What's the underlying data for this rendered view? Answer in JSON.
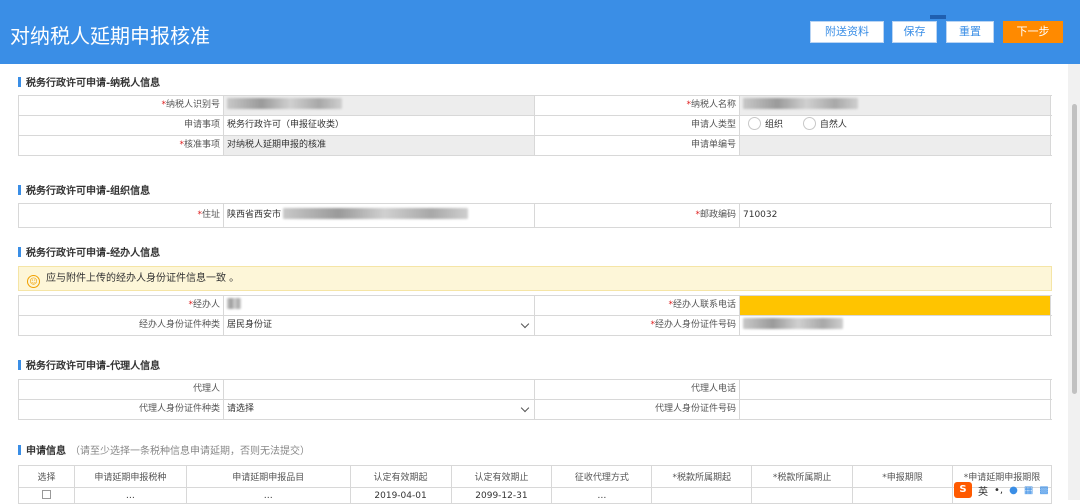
{
  "header": {
    "title": "对纳税人延期申报核准",
    "buttons": {
      "attach": "附送资料",
      "save": "保存",
      "reset": "重置",
      "next": "下一步"
    }
  },
  "sections": {
    "taxpayer": "税务行政许可申请-纳税人信息",
    "org": "税务行政许可申请-组织信息",
    "agent": "税务行政许可申请-经办人信息",
    "proxy": "税务行政许可申请-代理人信息",
    "apply": "申请信息",
    "apply_hint": "（请至少选择一条税种信息申请延期，否则无法提交）"
  },
  "taxpayer": {
    "id_label": "纳税人识别号",
    "name_label": "纳税人名称",
    "item_label": "申请事项",
    "item_value": "税务行政许可（申报征收类）",
    "type_label": "申请人类型",
    "type_opt1": "组织",
    "type_opt2": "自然人",
    "approve_label": "核准事项",
    "approve_value": "对纳税人延期申报的核准",
    "doc_label": "申请单编号"
  },
  "org": {
    "address_label": "住址",
    "address_value": "陕西省西安市",
    "zip_label": "邮政编码",
    "zip_value": "710032"
  },
  "agent": {
    "notice": "应与附件上传的经办人身份证件信息一致 。",
    "name_label": "经办人",
    "phone_label": "经办人联系电话",
    "idtype_label": "经办人身份证件种类",
    "idtype_value": "居民身份证",
    "idno_label": "经办人身份证件号码"
  },
  "proxy": {
    "name_label": "代理人",
    "phone_label": "代理人电话",
    "idtype_label": "代理人身份证件种类",
    "idtype_value": "请选择",
    "idno_label": "代理人身份证件号码"
  },
  "apply_table": {
    "columns": [
      "选择",
      "申请延期申报税种",
      "申请延期申报品目",
      "认定有效期起",
      "认定有效期止",
      "征收代理方式",
      "*税款所属期起",
      "*税款所属期止",
      "*申报期限",
      "*申请延期申报期限"
    ],
    "partial_row": [
      "",
      "…",
      "…",
      "2019-04-01",
      "2099-12-31",
      "…",
      "",
      "",
      "",
      ""
    ]
  },
  "ime": {
    "lang": "英",
    "icon": "sogou-icon"
  }
}
